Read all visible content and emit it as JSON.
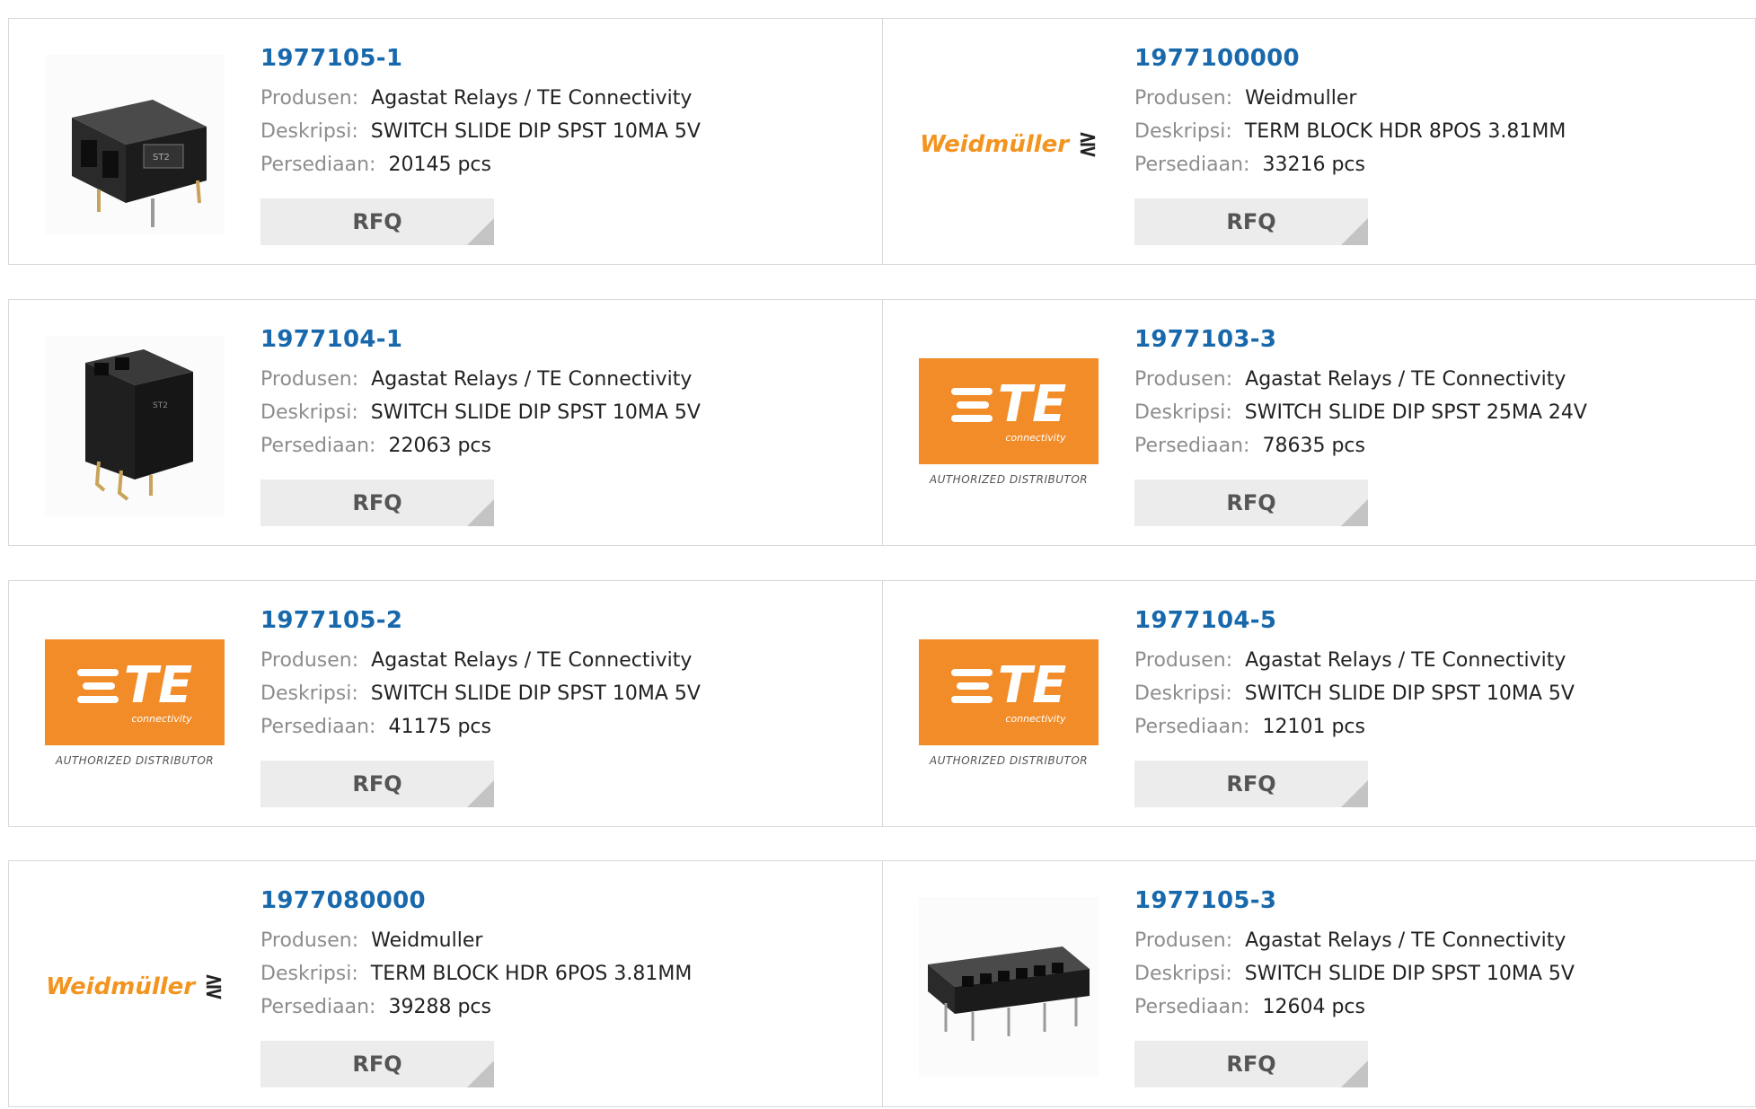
{
  "labels": {
    "manufacturer": "Produsen:",
    "description": "Deskripsi:",
    "stock": "Persediaan:",
    "rfq": "RFQ"
  },
  "brand_texts": {
    "te_wordmark": "TE",
    "te_sub": "connectivity",
    "te_authorized": "AUTHORIZED DISTRIBUTOR",
    "weidmuller": "Weidmüller"
  },
  "colors": {
    "part_link": "#1868ac",
    "te_orange": "#f28c28",
    "weidmuller_orange": "#f2941f",
    "rfq_bg": "#ececec"
  },
  "products": [
    {
      "part": "1977105-1",
      "manufacturer": "Agastat Relays / TE Connectivity",
      "description": "SWITCH SLIDE DIP SPST 10MA 5V",
      "stock": "20145 pcs",
      "image": "dip-switch-2pos"
    },
    {
      "part": "1977100000",
      "manufacturer": "Weidmuller",
      "description": "TERM BLOCK HDR 8POS 3.81MM",
      "stock": "33216 pcs",
      "image": "weidmuller-logo"
    },
    {
      "part": "1977104-1",
      "manufacturer": "Agastat Relays / TE Connectivity",
      "description": "SWITCH SLIDE DIP SPST 10MA 5V",
      "stock": "22063 pcs",
      "image": "dip-switch-vertical"
    },
    {
      "part": "1977103-3",
      "manufacturer": "Agastat Relays / TE Connectivity",
      "description": "SWITCH SLIDE DIP SPST 25MA 24V",
      "stock": "78635 pcs",
      "image": "te-logo"
    },
    {
      "part": "1977105-2",
      "manufacturer": "Agastat Relays / TE Connectivity",
      "description": "SWITCH SLIDE DIP SPST 10MA 5V",
      "stock": "41175 pcs",
      "image": "te-logo"
    },
    {
      "part": "1977104-5",
      "manufacturer": "Agastat Relays / TE Connectivity",
      "description": "SWITCH SLIDE DIP SPST 10MA 5V",
      "stock": "12101 pcs",
      "image": "te-logo"
    },
    {
      "part": "1977080000",
      "manufacturer": "Weidmuller",
      "description": "TERM BLOCK HDR 6POS 3.81MM",
      "stock": "39288 pcs",
      "image": "weidmuller-logo"
    },
    {
      "part": "1977105-3",
      "manufacturer": "Agastat Relays / TE Connectivity",
      "description": "SWITCH SLIDE DIP SPST 10MA 5V",
      "stock": "12604 pcs",
      "image": "dip-switch-6pos"
    }
  ]
}
